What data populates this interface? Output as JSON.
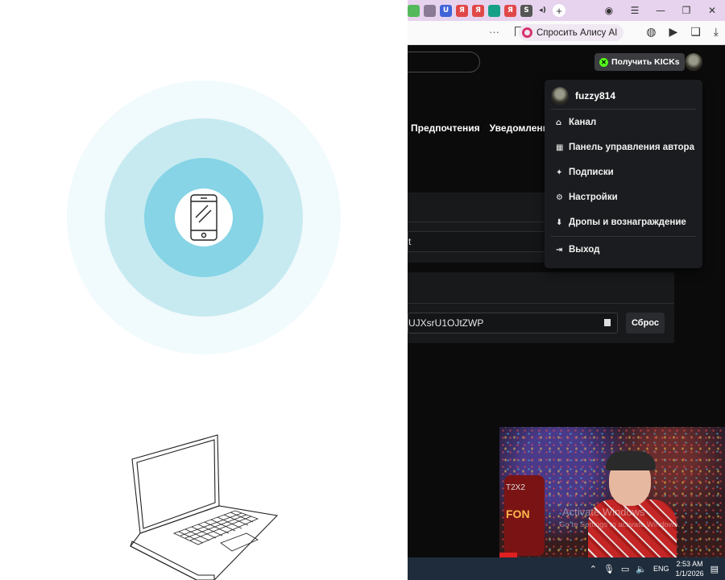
{
  "colors": {
    "ring_outer": "#f1fafc",
    "ring_mid": "#c7eaf1",
    "ring_inner": "#86d4e6",
    "page_bg": "#0b0b0c",
    "tabstrip_bg": "#e7d3ee",
    "kick_green": "#53fc18",
    "taskbar_bg": "#1f2c3c"
  },
  "left_panel": {
    "center_icon": "smartphone-icon",
    "bottom_illustration": "laptop-icon"
  },
  "browser": {
    "tabs": [
      {
        "icon": "kick-tab-icon",
        "label": "",
        "color": "#53b95a"
      },
      {
        "icon": "doc-tab-icon",
        "label": "",
        "color": "#8a7a96"
      },
      {
        "icon": "u-tab-icon",
        "label": "U",
        "color": "#4063d8"
      },
      {
        "icon": "yandex-tab-icon",
        "label": "Я",
        "color": "#e04848"
      },
      {
        "icon": "yandex-tab-icon",
        "label": "Я",
        "color": "#e04848"
      },
      {
        "icon": "teal-tab-icon",
        "label": "",
        "color": "#16a085"
      },
      {
        "icon": "yandex-tab-icon",
        "label": "Я",
        "color": "#e04848"
      },
      {
        "icon": "s-tab-icon",
        "label": "S",
        "color": "#555555"
      }
    ],
    "address_more": "···",
    "alice_button": "Спросить Алису AI",
    "window_controls": {
      "minimize": "—",
      "restore": "❐",
      "close": "✕"
    }
  },
  "kick": {
    "get_kicks_button": "Получить KICKs",
    "nav_tabs": [
      "Предпочтения",
      "Уведомления"
    ],
    "section1_input_value": "t",
    "stream_key_value": "UJXsrU1OJtZWP",
    "reset_button": "Сброс",
    "menu": {
      "username": "fuzzy814",
      "items": [
        {
          "icon": "channel-icon",
          "glyph": "⌂",
          "label": "Канал"
        },
        {
          "icon": "dashboard-icon",
          "glyph": "▦",
          "label": "Панель управления автора"
        },
        {
          "icon": "sparkle-icon",
          "glyph": "✦",
          "label": "Подписки"
        },
        {
          "icon": "gear-icon",
          "glyph": "⚙",
          "label": "Настройки"
        },
        {
          "icon": "drops-icon",
          "glyph": "⬇",
          "label": "Дропы и вознаграждение"
        }
      ],
      "logout": {
        "icon": "logout-icon",
        "glyph": "⇥",
        "label": "Выход"
      }
    }
  },
  "video_overlay": {
    "sign_text": "FON",
    "sign_text2": "T2X2",
    "watermark_title": "Activate Windows",
    "watermark_sub": "Go to Settings to activate Windows."
  },
  "taskbar": {
    "language": "ENG",
    "time": "2:53 AM",
    "date": "1/1/2026"
  }
}
